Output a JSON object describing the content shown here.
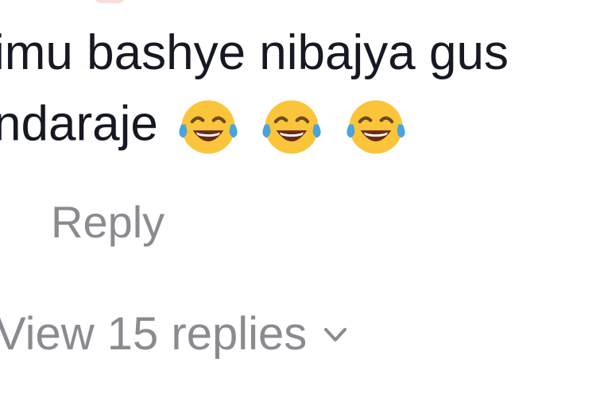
{
  "comment": {
    "line1": "imu bashye nibajya gus",
    "line2_text": "ndaraje",
    "emojis": [
      "face-with-tears-of-joy",
      "face-with-tears-of-joy",
      "face-with-tears-of-joy"
    ]
  },
  "actions": {
    "reply_label": "Reply",
    "view_replies_label": "View 15 replies",
    "view_replies_icon": "chevron-down-icon"
  },
  "colors": {
    "text": "#161823",
    "muted": "#8a8b91",
    "emoji_face": "#fbc53b",
    "emoji_tear": "#4aa3df"
  }
}
